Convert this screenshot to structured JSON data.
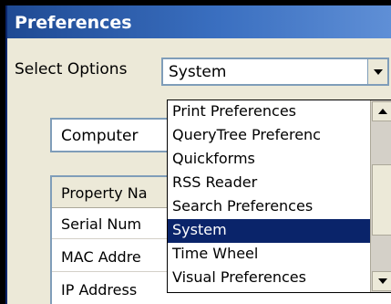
{
  "window": {
    "title": "Preferences"
  },
  "select_options": {
    "label": "Select Options",
    "value": "System"
  },
  "behind": {
    "combo_value": "Computer"
  },
  "table": {
    "header": "Property Na",
    "rows": [
      "Serial Num",
      "MAC Addre",
      "IP Address"
    ]
  },
  "dropdown": {
    "items": [
      "Print Preferences",
      "QueryTree Preferenc",
      "Quickforms",
      "RSS Reader",
      "Search Preferences",
      "System",
      "Time Wheel",
      "Visual Preferences"
    ],
    "selected_index": 5,
    "scroll_position": 0.55
  },
  "colors": {
    "title_bar": "#1F4A93",
    "selection": "#0A246A",
    "window_bg": "#ECE9D8"
  }
}
